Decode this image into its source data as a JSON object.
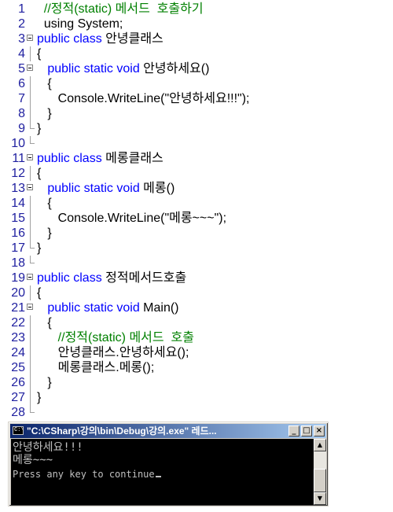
{
  "editor": {
    "lines": [
      {
        "num": "1",
        "parts": [
          {
            "t": "  //정적(static) 메서드  호출하기",
            "c": "c"
          }
        ]
      },
      {
        "num": "2",
        "parts": [
          {
            "t": "  using System;",
            "c": ""
          }
        ]
      },
      {
        "num": "3",
        "parts": [
          {
            "t": "public class ",
            "c": "kw"
          },
          {
            "t": "안녕클래스",
            "c": ""
          }
        ]
      },
      {
        "num": "4",
        "parts": [
          {
            "t": "{",
            "c": ""
          }
        ]
      },
      {
        "num": "5",
        "parts": [
          {
            "t": "   public static void ",
            "c": "kw"
          },
          {
            "t": "안녕하세요()",
            "c": ""
          }
        ]
      },
      {
        "num": "6",
        "parts": [
          {
            "t": "   {",
            "c": ""
          }
        ]
      },
      {
        "num": "7",
        "parts": [
          {
            "t": "      Console.WriteLine(\"안녕하세요!!!\");",
            "c": ""
          }
        ]
      },
      {
        "num": "8",
        "parts": [
          {
            "t": "   }",
            "c": ""
          }
        ]
      },
      {
        "num": "9",
        "parts": [
          {
            "t": "}",
            "c": ""
          }
        ]
      },
      {
        "num": "10",
        "parts": []
      },
      {
        "num": "11",
        "parts": [
          {
            "t": "public class ",
            "c": "kw"
          },
          {
            "t": "메롱클래스",
            "c": ""
          }
        ]
      },
      {
        "num": "12",
        "parts": [
          {
            "t": "{",
            "c": ""
          }
        ]
      },
      {
        "num": "13",
        "parts": [
          {
            "t": "   public static void ",
            "c": "kw"
          },
          {
            "t": "메롱()",
            "c": ""
          }
        ]
      },
      {
        "num": "14",
        "parts": [
          {
            "t": "   {",
            "c": ""
          }
        ]
      },
      {
        "num": "15",
        "parts": [
          {
            "t": "      Console.WriteLine(\"메롱~~~\");",
            "c": ""
          }
        ]
      },
      {
        "num": "16",
        "parts": [
          {
            "t": "   }",
            "c": ""
          }
        ]
      },
      {
        "num": "17",
        "parts": [
          {
            "t": "}",
            "c": ""
          }
        ]
      },
      {
        "num": "18",
        "parts": []
      },
      {
        "num": "19",
        "parts": [
          {
            "t": "public class ",
            "c": "kw"
          },
          {
            "t": "정적메서드호출",
            "c": ""
          }
        ]
      },
      {
        "num": "20",
        "parts": [
          {
            "t": "{",
            "c": ""
          }
        ]
      },
      {
        "num": "21",
        "parts": [
          {
            "t": "   public static void ",
            "c": "kw"
          },
          {
            "t": "Main()",
            "c": ""
          }
        ]
      },
      {
        "num": "22",
        "parts": [
          {
            "t": "   {",
            "c": ""
          }
        ]
      },
      {
        "num": "23",
        "parts": [
          {
            "t": "      //정적(static) 메서드  호출",
            "c": "c"
          }
        ]
      },
      {
        "num": "24",
        "parts": [
          {
            "t": "      안녕클래스.안녕하세요();",
            "c": ""
          }
        ]
      },
      {
        "num": "25",
        "parts": [
          {
            "t": "      메롱클래스.메롱();",
            "c": ""
          }
        ]
      },
      {
        "num": "26",
        "parts": [
          {
            "t": "   }",
            "c": ""
          }
        ]
      },
      {
        "num": "27",
        "parts": [
          {
            "t": "}",
            "c": ""
          }
        ]
      },
      {
        "num": "28",
        "parts": []
      }
    ]
  },
  "console": {
    "icon_label": "C:\\",
    "title": "\"C:\\CSharp\\강의\\bin\\Debug\\강의.exe\" 레드...",
    "minimize_label": "_",
    "maximize_label": "□",
    "close_label": "×",
    "output": [
      "안녕하세요!!!",
      "메롱~~~",
      "Press any key to continue"
    ],
    "scroll_up": "▲",
    "scroll_down": "▼"
  },
  "colors": {
    "keyword": "#0000ff",
    "comment": "#008000",
    "line_number": "#2020a0",
    "console_bg": "#000000",
    "console_text": "#c0c0c0",
    "titlebar_start": "#0a246a",
    "titlebar_end": "#a6caf0"
  }
}
